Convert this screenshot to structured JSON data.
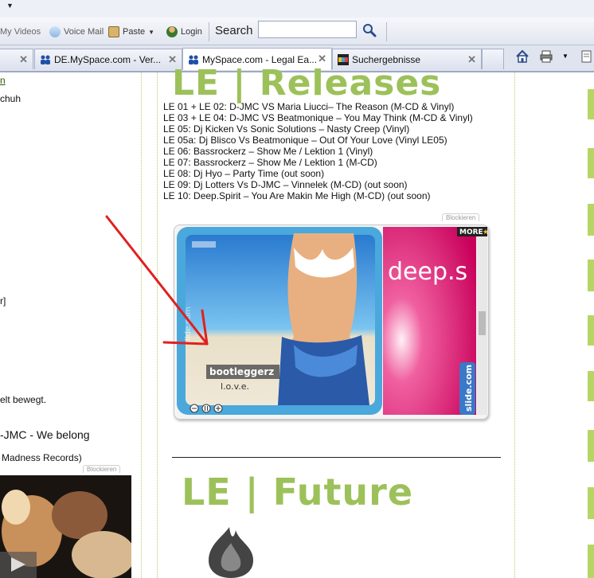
{
  "toolbar": {
    "my_videos": "My Videos",
    "voice_mail": "Voice Mail",
    "paste": "Paste",
    "login": "Login",
    "search_label": "Search",
    "search_value": ""
  },
  "tabs": [
    {
      "title": "",
      "active": false
    },
    {
      "title": "DE.MySpace.com - Ver...",
      "active": false
    },
    {
      "title": "MySpace.com - Legal Ea...",
      "active": true
    },
    {
      "title": "Suchergebnisse",
      "active": false
    },
    {
      "title": "",
      "active": false
    }
  ],
  "left_column": {
    "fragment_1": "n",
    "fragment_2": "chuh",
    "fragment_3": "r]",
    "fragment_4": "elt bewegt.",
    "fragment_5": "-JMC - We belong",
    "fragment_6": "Madness Records)",
    "blockieren": "Blockieren"
  },
  "main": {
    "heading_releases": "LE | Releases",
    "releases": [
      "LE 01 + LE 02: D-JMC VS Maria Liucci– The Reason (M-CD & Vinyl)",
      "LE 03 + LE 04: D-JMC VS Beatmonique – You May Think (M-CD & Vinyl)",
      "LE 05: Dj Kicken Vs Sonic Solutions – Nasty Creep (Vinyl)",
      "LE 05a: Dj Blisco Vs Beatmonique – Out Of Your Love (Vinyl LE05)",
      "LE 06: Bassrockerz – Show Me / Lektion 1 (Vinyl)",
      "LE 07: Bassrockerz – Show Me / Lektion 1 (M-CD)",
      "LE 08: Dj Hyo – Party Time (out soon)",
      "LE 09: Dj Lotters Vs D-JMC – Vinnelek (M-CD) (out soon)",
      "LE 10: Deep.Spirit – You Are Makin Me High (M-CD) (out soon)"
    ],
    "blockieren": "Blockieren",
    "slide_more": "MORE",
    "slide_brand": "slide.com",
    "slide_caption_1": "bootleggerz",
    "slide_caption_2": "l.o.v.e.",
    "slide_right_text": "deep.s",
    "heading_future": "LE | Future"
  },
  "colors": {
    "heading_green": "#9dc15a",
    "slide_frame_blue": "#4aa8dc",
    "slide_pink": "#e0307a",
    "arrow_red": "#e02020"
  }
}
